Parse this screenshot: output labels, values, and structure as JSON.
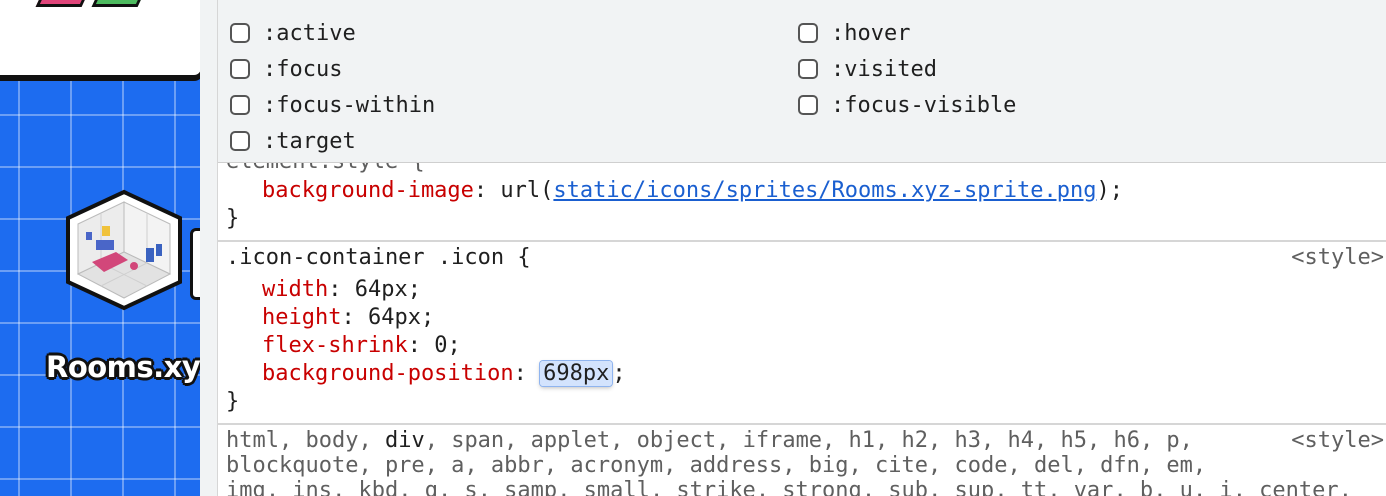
{
  "page": {
    "card_label": "Rooms.xy"
  },
  "force_state": {
    "items": [
      {
        "label": ":active"
      },
      {
        "label": ":hover"
      },
      {
        "label": ":focus"
      },
      {
        "label": ":visited"
      },
      {
        "label": ":focus-within"
      },
      {
        "label": ":focus-visible"
      },
      {
        "label": ":target"
      }
    ]
  },
  "rules": {
    "element_style": {
      "clipped_selector": "element.style {",
      "property": "background-image",
      "value_prefix": "url(",
      "url": "static/icons/sprites/Rooms.xyz-sprite.png",
      "value_suffix": ");",
      "close": "}"
    },
    "icon_rule": {
      "selector": ".icon-container .icon {",
      "origin": "<style>",
      "declarations": [
        {
          "property": "width",
          "value": "64px"
        },
        {
          "property": "height",
          "value": "64px"
        },
        {
          "property": "flex-shrink",
          "value": "0"
        },
        {
          "property": "background-position",
          "value": "698px"
        }
      ],
      "close": "}"
    },
    "reset_rule": {
      "origin": "<style>",
      "line1_a": "html, body, ",
      "line1_b": "div",
      "line1_c": ", span, applet, object, iframe, h1, h2, h3, h4, h5, h6, p,",
      "line2": "blockquote, pre, a, abbr, acronym, address, big, cite, code, del, dfn, em,",
      "line3": "img, ins, kbd, q, s, samp, small, strike, strong, sub, sup, tt, var, b, u, i, center,"
    }
  },
  "colors": {
    "property": "#c80000",
    "url": "#1a5fd0",
    "page_background": "#1d6cf0",
    "editing_highlight": "#d3e3fd"
  }
}
